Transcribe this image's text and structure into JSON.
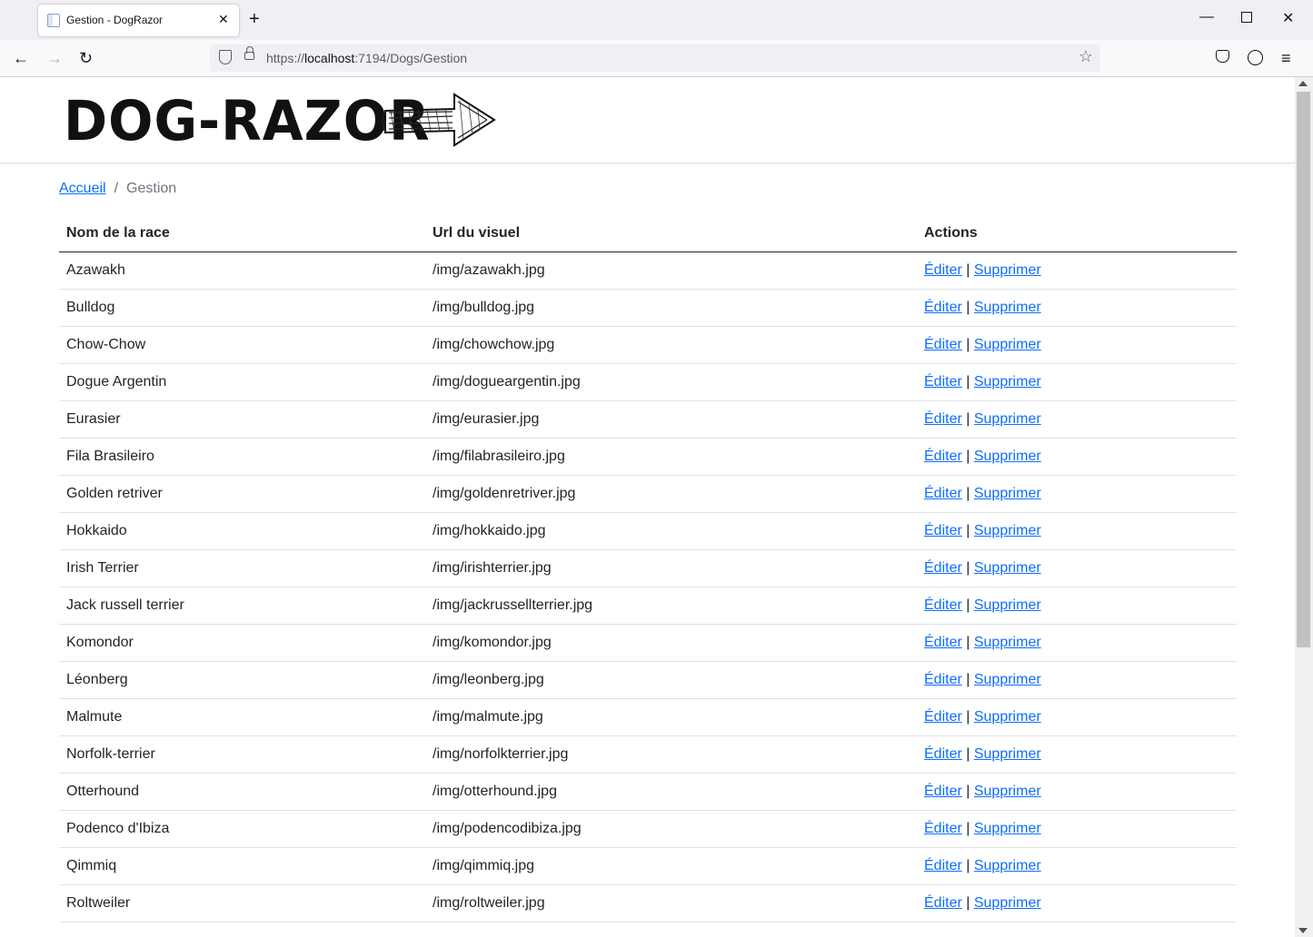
{
  "browser": {
    "tab_title": "Gestion - DogRazor",
    "url_prefix": "https://",
    "url_host": "localhost",
    "url_rest": ":7194/Dogs/Gestion"
  },
  "header": {
    "logo_text": "DOG-RAZOR"
  },
  "breadcrumb": {
    "home": "Accueil",
    "separator": "/",
    "current": "Gestion"
  },
  "table": {
    "headers": [
      "Nom de la race",
      "Url du visuel",
      "Actions"
    ],
    "edit_label": "Éditer",
    "action_separator": "|",
    "delete_label": "Supprimer",
    "rows": [
      {
        "name": "Azawakh",
        "url": "/img/azawakh.jpg"
      },
      {
        "name": "Bulldog",
        "url": "/img/bulldog.jpg"
      },
      {
        "name": "Chow-Chow",
        "url": "/img/chowchow.jpg"
      },
      {
        "name": "Dogue Argentin",
        "url": "/img/dogueargentin.jpg"
      },
      {
        "name": "Eurasier",
        "url": "/img/eurasier.jpg"
      },
      {
        "name": "Fila Brasileiro",
        "url": "/img/filabrasileiro.jpg"
      },
      {
        "name": "Golden retriver",
        "url": "/img/goldenretriver.jpg"
      },
      {
        "name": "Hokkaido",
        "url": "/img/hokkaido.jpg"
      },
      {
        "name": "Irish Terrier",
        "url": "/img/irishterrier.jpg"
      },
      {
        "name": "Jack russell terrier",
        "url": "/img/jackrussellterrier.jpg"
      },
      {
        "name": "Komondor",
        "url": "/img/komondor.jpg"
      },
      {
        "name": "Léonberg",
        "url": "/img/leonberg.jpg"
      },
      {
        "name": "Malmute",
        "url": "/img/malmute.jpg"
      },
      {
        "name": "Norfolk-terrier",
        "url": "/img/norfolkterrier.jpg"
      },
      {
        "name": "Otterhound",
        "url": "/img/otterhound.jpg"
      },
      {
        "name": "Podenco d'Ibiza",
        "url": "/img/podencodibiza.jpg"
      },
      {
        "name": "Qimmiq",
        "url": "/img/qimmiq.jpg"
      },
      {
        "name": "Roltweiler",
        "url": "/img/roltweiler.jpg"
      }
    ]
  }
}
